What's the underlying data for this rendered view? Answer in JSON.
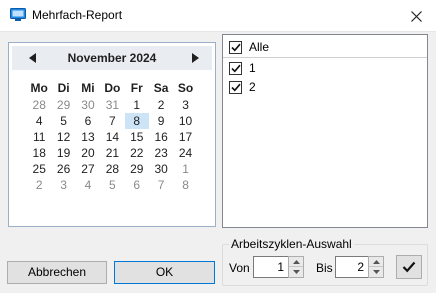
{
  "window": {
    "title": "Mehrfach-Report",
    "app_icon": "report-icon",
    "close_icon": "close-icon"
  },
  "calendar": {
    "month_label": "November 2024",
    "prev_icon": "left-triangle-icon",
    "next_icon": "right-triangle-icon",
    "weekdays": [
      "Mo",
      "Di",
      "Mi",
      "Do",
      "Fr",
      "Sa",
      "So"
    ],
    "weeks": [
      [
        "28",
        "29",
        "30",
        "31",
        "1",
        "2",
        "3"
      ],
      [
        "4",
        "5",
        "6",
        "7",
        "8",
        "9",
        "10"
      ],
      [
        "11",
        "12",
        "13",
        "14",
        "15",
        "16",
        "17"
      ],
      [
        "18",
        "19",
        "20",
        "21",
        "22",
        "23",
        "24"
      ],
      [
        "25",
        "26",
        "27",
        "28",
        "29",
        "30",
        "1"
      ],
      [
        "2",
        "3",
        "4",
        "5",
        "6",
        "7",
        "8"
      ]
    ],
    "selected_day": "8",
    "selected_color": "#cde4f7"
  },
  "checklist": {
    "all_label": "Alle",
    "items": [
      {
        "label": "1",
        "checked": true
      },
      {
        "label": "2",
        "checked": true
      }
    ],
    "all_checked": true
  },
  "buttons": {
    "cancel_label": "Abbrechen",
    "ok_label": "OK",
    "accent_color": "#0078d7"
  },
  "cycle_selection": {
    "legend": "Arbeitszyklen-Auswahl",
    "from_label": "Von",
    "from_value": "1",
    "to_label": "Bis",
    "to_value": "2",
    "apply_icon": "checkmark-icon"
  }
}
